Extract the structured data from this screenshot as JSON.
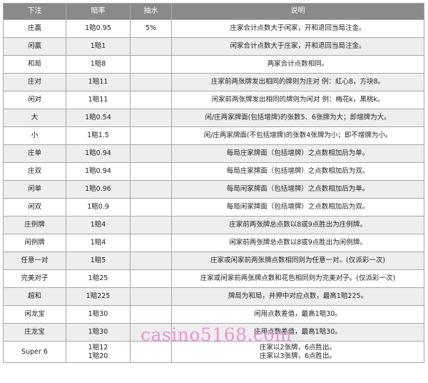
{
  "headers": {
    "bet": "下注",
    "odds": "賠率",
    "commission": "抽水",
    "description": "说明"
  },
  "rows": [
    {
      "bet": "庄赢",
      "odds": "1賠0.95",
      "commission": "5%",
      "description": "庄家合计点数大于闲家，开和退回当局注金。"
    },
    {
      "bet": "闲赢",
      "odds": "1賠1",
      "commission": "",
      "description": "闲家合计点数大于庄家，开和退回当局注金。"
    },
    {
      "bet": "和局",
      "odds": "1賠8",
      "commission": "",
      "description": "两家合计点数相同。"
    },
    {
      "bet": "庄对",
      "odds": "1賠11",
      "commission": "",
      "description": "庄家前两张牌发出相同的牌则为庄对 例：紅心8，方块8。"
    },
    {
      "bet": "闲对",
      "odds": "1賠11",
      "commission": "",
      "description": "闲家前两张牌发出相同的牌则为闲对 例：梅花k，黑桃k。"
    },
    {
      "bet": "大",
      "odds": "1賠0.54",
      "commission": "",
      "description": "闲/庄两家牌面(包括增牌)的张数5、6张牌为大；即增牌为大。"
    },
    {
      "bet": "小",
      "odds": "1賠1.5",
      "commission": "",
      "description": "闲/庄两家牌面(不包括增牌)的张数4张牌为小；即不增牌为小。"
    },
    {
      "bet": "庄单",
      "odds": "1賠0.94",
      "commission": "",
      "description": "每局庄家牌面（包括增牌）之点数相加后为单。"
    },
    {
      "bet": "庄双",
      "odds": "1賠0.94",
      "commission": "",
      "description": "每局庄家牌面（包括增牌）之点数相加后为双。"
    },
    {
      "bet": "闲单",
      "odds": "1賠0.96",
      "commission": "",
      "description": "每局闲家牌面（包括增牌）之点数相加后为单。"
    },
    {
      "bet": "闲双",
      "odds": "1賠0.9",
      "commission": "",
      "description": "每局闲家牌面（包括增牌）之点数相加后为双。"
    },
    {
      "bet": "庄例牌",
      "odds": "1賠4",
      "commission": "",
      "description": "庄家前两张牌总点数以8或9点胜出为庄例牌。"
    },
    {
      "bet": "闲例牌",
      "odds": "1賠4",
      "commission": "",
      "description": "闲家前两张牌总点数以8或9点胜出为闲例牌。"
    },
    {
      "bet": "任意一对",
      "odds": "1賠5",
      "commission": "",
      "description": "庄家或闲家前两张牌点数相同则为任意一对。(仅派彩一次)"
    },
    {
      "bet": "完美对子",
      "odds": "1賠25",
      "commission": "",
      "description": "庄家或闲家前两张牌点数和花色相同则为完美对子。(仅派彩一次)"
    },
    {
      "bet": "超和",
      "odds": "1賠225",
      "commission": "",
      "description": "牌局为和局，并押中对应点数，最高1賠225。"
    },
    {
      "bet": "闲龙宝",
      "odds": "1賠30",
      "commission": "",
      "description": "闲用点数差值，最高1賠30。"
    },
    {
      "bet": "庄龙宝",
      "odds": "1賠30",
      "commission": "",
      "description": "庄用点数差值，最高1賠30。"
    }
  ],
  "last_row": {
    "bet": "Super 6",
    "odds_line1": "1賠12",
    "odds_line2": "1賠20",
    "commission": "",
    "desc_line1": "庄家以2张牌，6点胜出。",
    "desc_line2": "庄家以3张牌，6点胜出。"
  },
  "watermark": "casino5168.com"
}
